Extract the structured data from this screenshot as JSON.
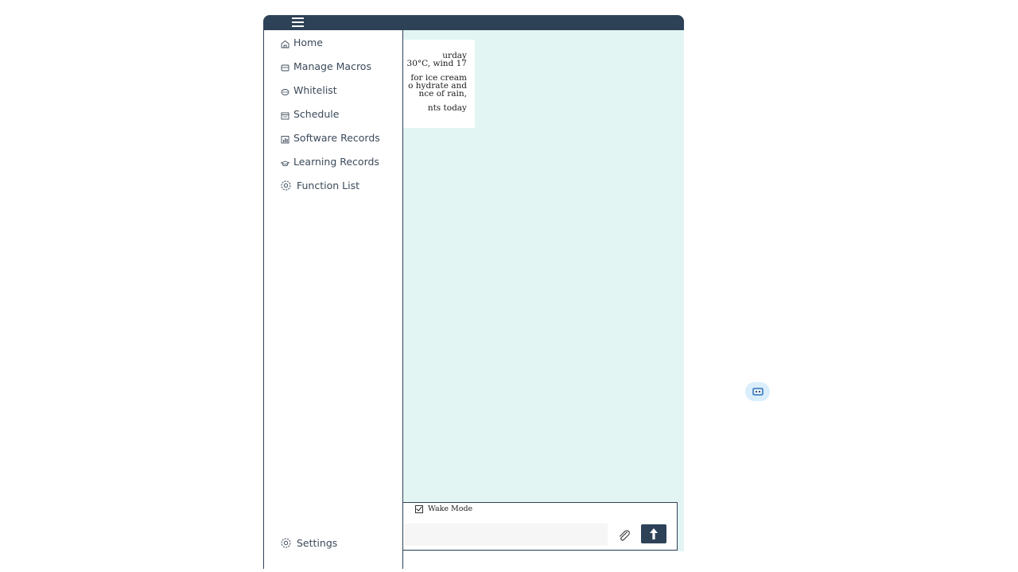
{
  "sidebar": {
    "items": [
      {
        "label": "Home",
        "icon": "home-icon"
      },
      {
        "label": "Manage Macros",
        "icon": "macro-icon"
      },
      {
        "label": "Whitelist",
        "icon": "whitelist-icon"
      },
      {
        "label": "Schedule",
        "icon": "schedule-icon"
      },
      {
        "label": "Software Records",
        "icon": "chart-icon"
      },
      {
        "label": "Learning Records",
        "icon": "graduation-cap-icon"
      },
      {
        "label": "Function List",
        "icon": "gear-icon"
      }
    ],
    "settings_label": "Settings"
  },
  "weather": {
    "lines": [
      "urday",
      "30°C, wind 17",
      "for ice cream",
      "o hydrate and",
      "nce of rain,",
      "nts today"
    ]
  },
  "input_panel": {
    "wake_mode_label": "Wake Mode",
    "wake_mode_checked": true,
    "message_value": "",
    "message_placeholder": ""
  },
  "colors": {
    "brand_dark": "#2e4257",
    "content_bg": "#e3f5f3",
    "bot_bubble": "#dbeefc"
  }
}
